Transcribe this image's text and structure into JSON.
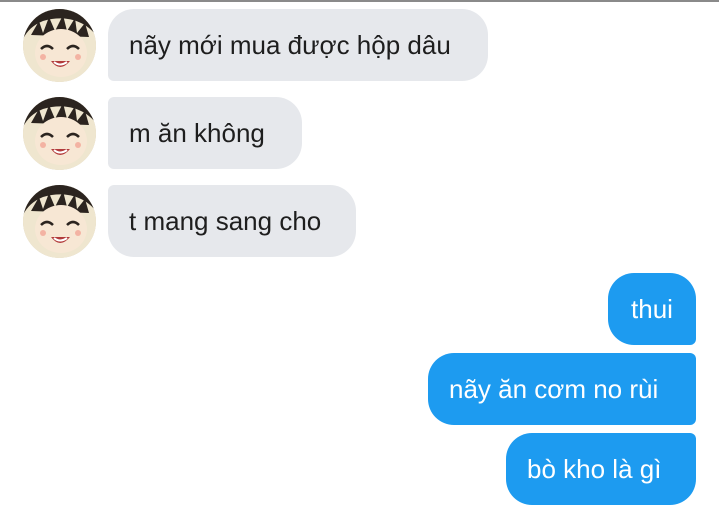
{
  "conversation": {
    "incoming": [
      {
        "text": "nãy mới mua được hộp dâu"
      },
      {
        "text": "m ăn không"
      },
      {
        "text": "t mang sang cho"
      }
    ],
    "outgoing": [
      {
        "text": "thui"
      },
      {
        "text": "nãy ăn cơm no rùi"
      },
      {
        "text": "bò kho là gì"
      }
    ]
  },
  "colors": {
    "incoming_bubble": "#e6e8ec",
    "outgoing_bubble": "#1d9bf0",
    "incoming_text": "#1e1e1e",
    "outgoing_text": "#ffffff"
  }
}
